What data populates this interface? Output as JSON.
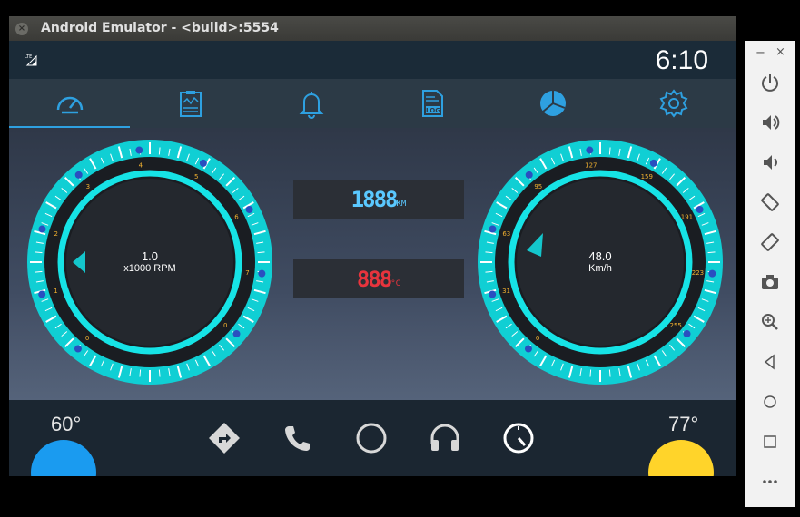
{
  "window": {
    "title": "Android Emulator - <build>:5554",
    "close_glyph": "×"
  },
  "status": {
    "network": "LTE",
    "clock": "6:10"
  },
  "tabs": [
    {
      "icon": "speedometer-icon",
      "active": true
    },
    {
      "icon": "clipboard-chart-icon",
      "active": false
    },
    {
      "icon": "bell-icon",
      "active": false
    },
    {
      "icon": "log-file-icon",
      "label": "LOG",
      "active": false
    },
    {
      "icon": "pie-chart-icon",
      "active": false
    },
    {
      "icon": "gear-icon",
      "active": false
    }
  ],
  "rpm_gauge": {
    "value": "1.0",
    "unit": "x1000 RPM",
    "ticks": [
      "0",
      "1",
      "2",
      "3",
      "4",
      "5",
      "6",
      "7",
      "0"
    ]
  },
  "speed_gauge": {
    "value": "48.0",
    "unit": "Km/h",
    "ticks": [
      "0",
      "31",
      "63",
      "95",
      "127",
      "159",
      "191",
      "223",
      "255"
    ]
  },
  "odometer": {
    "value": "1888",
    "unit": "KM"
  },
  "coolant": {
    "value": "888",
    "unit": "°C"
  },
  "climate": {
    "left_temp": "60°",
    "right_temp": "77°",
    "left_color": "#1a9bf0",
    "right_color": "#ffd42a"
  },
  "nav": [
    {
      "icon": "directions-icon"
    },
    {
      "icon": "phone-icon"
    },
    {
      "icon": "home-circle-icon"
    },
    {
      "icon": "headphones-icon"
    },
    {
      "icon": "dashboard-gauge-icon"
    }
  ],
  "side_panel": {
    "minimize_glyph": "−",
    "close_glyph": "×",
    "buttons": [
      "power-icon",
      "volume-up-icon",
      "volume-down-icon",
      "rotate-left-icon",
      "rotate-right-icon",
      "camera-icon",
      "zoom-icon",
      "back-icon",
      "home-icon",
      "overview-icon",
      "more-icon"
    ]
  }
}
